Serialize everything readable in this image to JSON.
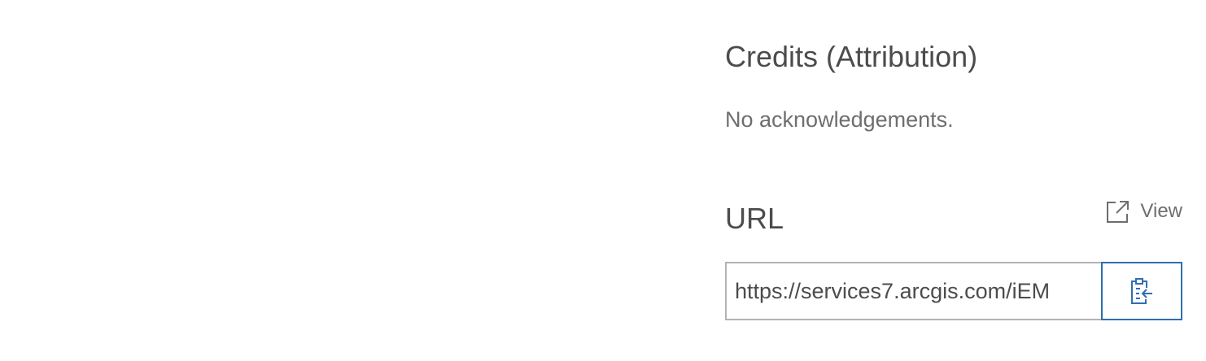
{
  "credits": {
    "title": "Credits (Attribution)",
    "text": "No acknowledgements."
  },
  "url_section": {
    "title": "URL",
    "view_label": "View",
    "view_icon": "external-link-icon",
    "url_value": "https://services7.arcgis.com/iEM",
    "copy_icon": "clipboard-copy-icon"
  },
  "colors": {
    "accent": "#2f6fb0",
    "text": "#4c4c4c",
    "muted_text": "#6e6e6e",
    "border": "#b3b3b3"
  }
}
